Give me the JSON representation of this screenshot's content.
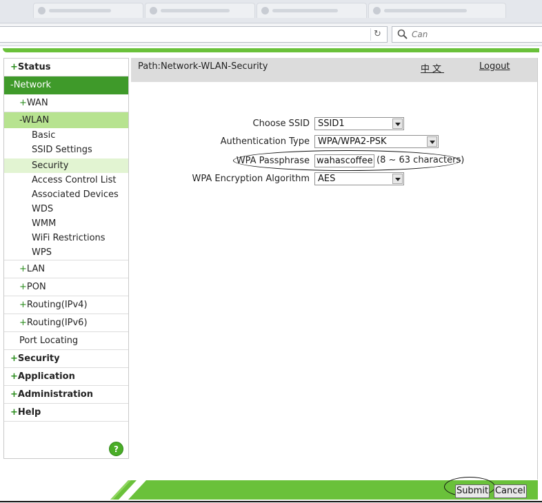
{
  "browser": {
    "search": {
      "placeholder": "Can"
    },
    "icons": {
      "reload": "reload-icon",
      "search": "search-icon"
    }
  },
  "header": {
    "path": "Path:Network-WLAN-Security",
    "language_link": "中文",
    "logout": "Logout"
  },
  "sidebar": {
    "status": {
      "plus": "+",
      "label": "Status"
    },
    "network": {
      "label": "-Network"
    },
    "wan": {
      "plus": "+",
      "label": "WAN"
    },
    "wlan": {
      "label": "-WLAN"
    },
    "wlan_items": [
      "Basic",
      "SSID Settings",
      "Security",
      "Access Control List",
      "Associated Devices",
      "WDS",
      "WMM",
      "WiFi Restrictions",
      "WPS"
    ],
    "lan": {
      "plus": "+",
      "label": "LAN"
    },
    "pon": {
      "plus": "+",
      "label": "PON"
    },
    "routing_v4": {
      "plus": "+",
      "label": "Routing(IPv4)"
    },
    "routing_v6": {
      "plus": "+",
      "label": "Routing(IPv6)"
    },
    "port_locating": {
      "label": "Port Locating"
    },
    "security": {
      "plus": "+",
      "label": "Security"
    },
    "application": {
      "plus": "+",
      "label": "Application"
    },
    "administration": {
      "plus": "+",
      "label": "Administration"
    },
    "help": {
      "plus": "+",
      "label": "Help"
    },
    "help_button": "?"
  },
  "form": {
    "ssid": {
      "label": "Choose SSID",
      "value": "SSID1"
    },
    "auth": {
      "label": "Authentication Type",
      "value": "WPA/WPA2-PSK"
    },
    "passphrase": {
      "label": "WPA Passphrase",
      "value": "wahascoffee",
      "hint": "(8 ~ 63 characters)"
    },
    "encryption": {
      "label": "WPA Encryption Algorithm",
      "value": "AES"
    }
  },
  "actions": {
    "submit": "Submit",
    "cancel": "Cancel"
  },
  "colors": {
    "brand_green": "#6ac13a",
    "active_green": "#3f9a2a",
    "sub_active_green": "#b7e390",
    "leaf_active_green": "#e2f4d2",
    "path_bar_gray": "#dcdcdc"
  }
}
